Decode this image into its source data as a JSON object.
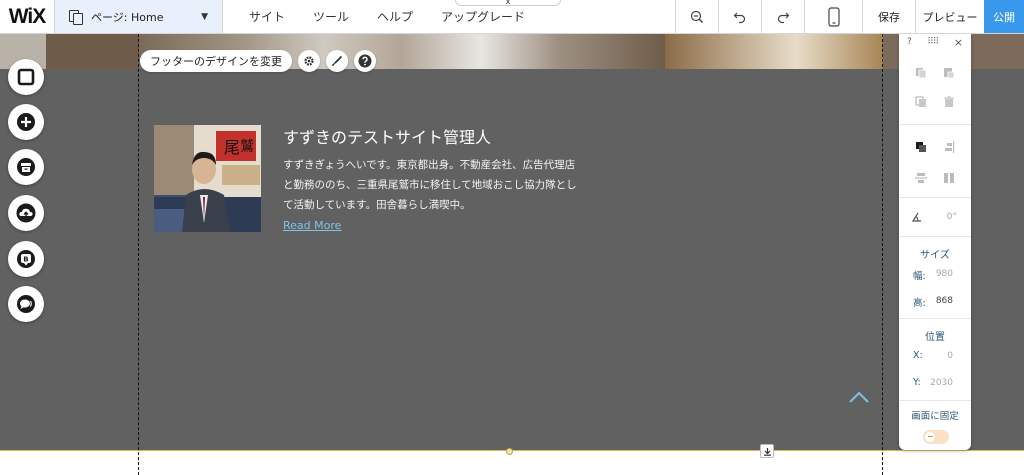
{
  "topbar": {
    "logo": "WiX",
    "page_selector": "ページ: Home",
    "menu": [
      "サイト",
      "ツール",
      "ヘルプ",
      "アップグレード"
    ],
    "save": "保存",
    "preview": "プレビュー",
    "publish": "公開"
  },
  "footer": {
    "edit_button": "フッターのデザインを変更",
    "author_name": "すずきのテストサイト管理人",
    "bio": "すずきぎょうへいです。東京都出身。不動産会社、広告代理店と勤務ののち、三重県尾鷲市に移住して地域おこし協力隊として活動しています。田舎暮らし満喫中。",
    "read_more": "Read More"
  },
  "panel": {
    "help": "?",
    "close": "×",
    "rotation": "0°",
    "size_heading": "サイズ",
    "width_label": "幅:",
    "width_value": "980",
    "height_label": "高:",
    "height_value": "868",
    "position_heading": "位置",
    "x_label": "X:",
    "x_value": "0",
    "y_label": "Y:",
    "y_value": "2030",
    "pin_label": "画面に固定"
  },
  "colors": {
    "accent": "#3899ec",
    "footer_bg": "#616161",
    "link": "#7ec3e6"
  }
}
